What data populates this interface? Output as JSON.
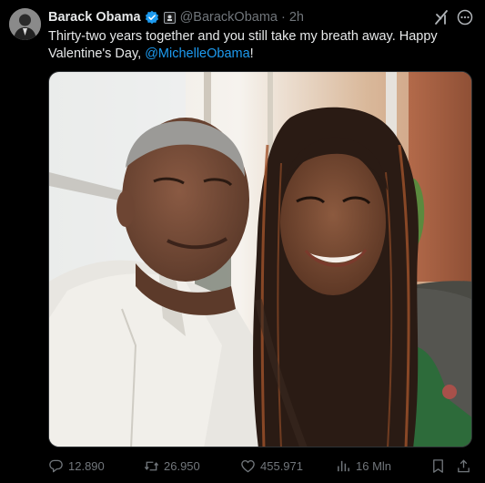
{
  "author": {
    "display_name": "Barack Obama",
    "handle": "@BarackObama",
    "separator": "·",
    "time": "2h",
    "verified_color": "#1d9bf0"
  },
  "tweet": {
    "text_before": "Thirty-two years together and you still take my breath away. Happy Valentine's Day, ",
    "mention": "@MichelleObama",
    "text_after": "!"
  },
  "actions": {
    "replies": "12.890",
    "retweets": "26.950",
    "likes": "455.971",
    "views": "16 Mln"
  },
  "colors": {
    "background": "#000000",
    "text": "#e7e9ea",
    "muted": "#71767b",
    "accent": "#1d9bf0"
  },
  "icons": {
    "reply": "reply-icon",
    "retweet": "retweet-icon",
    "like": "heart-icon",
    "views": "views-icon",
    "bookmark": "bookmark-icon",
    "share": "share-icon",
    "grok": "grok-icon",
    "more": "more-icon"
  }
}
